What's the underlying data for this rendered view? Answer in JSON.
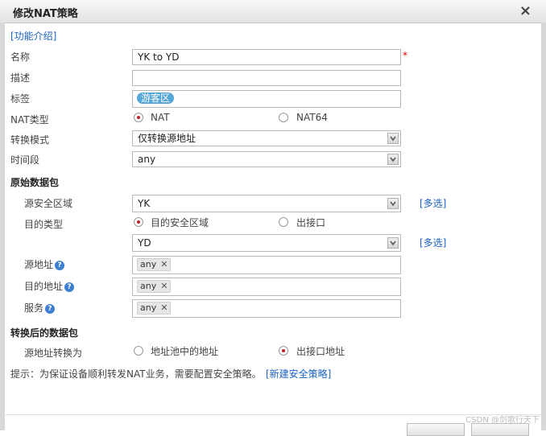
{
  "dialog": {
    "title": "修改NAT策略",
    "close_label": "×",
    "help_link": "[功能介绍]",
    "required_mark": "*"
  },
  "labels": {
    "name": "名称",
    "desc": "描述",
    "tag": "标签",
    "nat_type": "NAT类型",
    "mode": "转换模式",
    "time": "时间段",
    "src_zone": "源安全区域",
    "dst_type": "目的类型",
    "src_addr": "源地址",
    "dst_addr": "目的地址",
    "service": "服务",
    "src_translate": "源地址转换为"
  },
  "sections": {
    "original": "原始数据包",
    "translated": "转换后的数据包"
  },
  "values": {
    "name": "YK to YD",
    "desc": "",
    "tag": "游客区",
    "mode": "仅转换源地址",
    "time": "any",
    "src_zone": "YK",
    "dst_zone": "YD",
    "src_addr_chip": "any",
    "dst_addr_chip": "any",
    "service_chip": "any"
  },
  "options": {
    "nat": "NAT",
    "nat64": "NAT64",
    "dst_zone_opt": "目的安全区域",
    "egress_opt": "出接口",
    "pool_opt": "地址池中的地址",
    "egress_addr_opt": "出接口地址"
  },
  "links": {
    "multi1": "[多选]",
    "multi2": "[多选]",
    "new_policy": "[新建安全策略]"
  },
  "hint": "提示：为保证设备顺利转发NAT业务，需要配置安全策略。",
  "help_icon": "?",
  "chip_remove": "✕",
  "watermark": "CSDN @剑歌行天下",
  "colors": {
    "link": "#1a62c3",
    "tag_bg": "#56a7d8",
    "radio_dot": "#c0202a",
    "required": "#dd0000"
  }
}
